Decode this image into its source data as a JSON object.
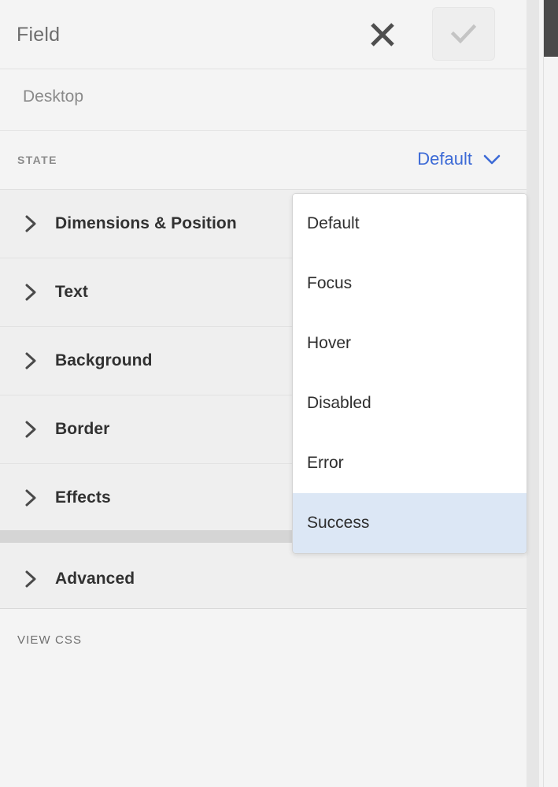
{
  "header": {
    "title": "Field",
    "close_icon": "close-x-icon",
    "confirm_icon": "check-icon"
  },
  "context": {
    "label": "Desktop"
  },
  "state": {
    "label": "STATE",
    "selected": "Default",
    "caret_icon": "chevron-down-icon",
    "accent_color": "#3c6ad6",
    "options": [
      "Default",
      "Focus",
      "Hover",
      "Disabled",
      "Error",
      "Success"
    ],
    "highlighted_option": "Success",
    "highlight_color": "#dce7f5"
  },
  "accordion": {
    "chevron_icon": "chevron-right-icon",
    "items": [
      {
        "label": "Dimensions & Position"
      },
      {
        "label": "Text"
      },
      {
        "label": "Background"
      },
      {
        "label": "Border"
      },
      {
        "label": "Effects"
      },
      {
        "label": "Advanced"
      }
    ]
  },
  "footer": {
    "view_css_label": "VIEW CSS"
  }
}
